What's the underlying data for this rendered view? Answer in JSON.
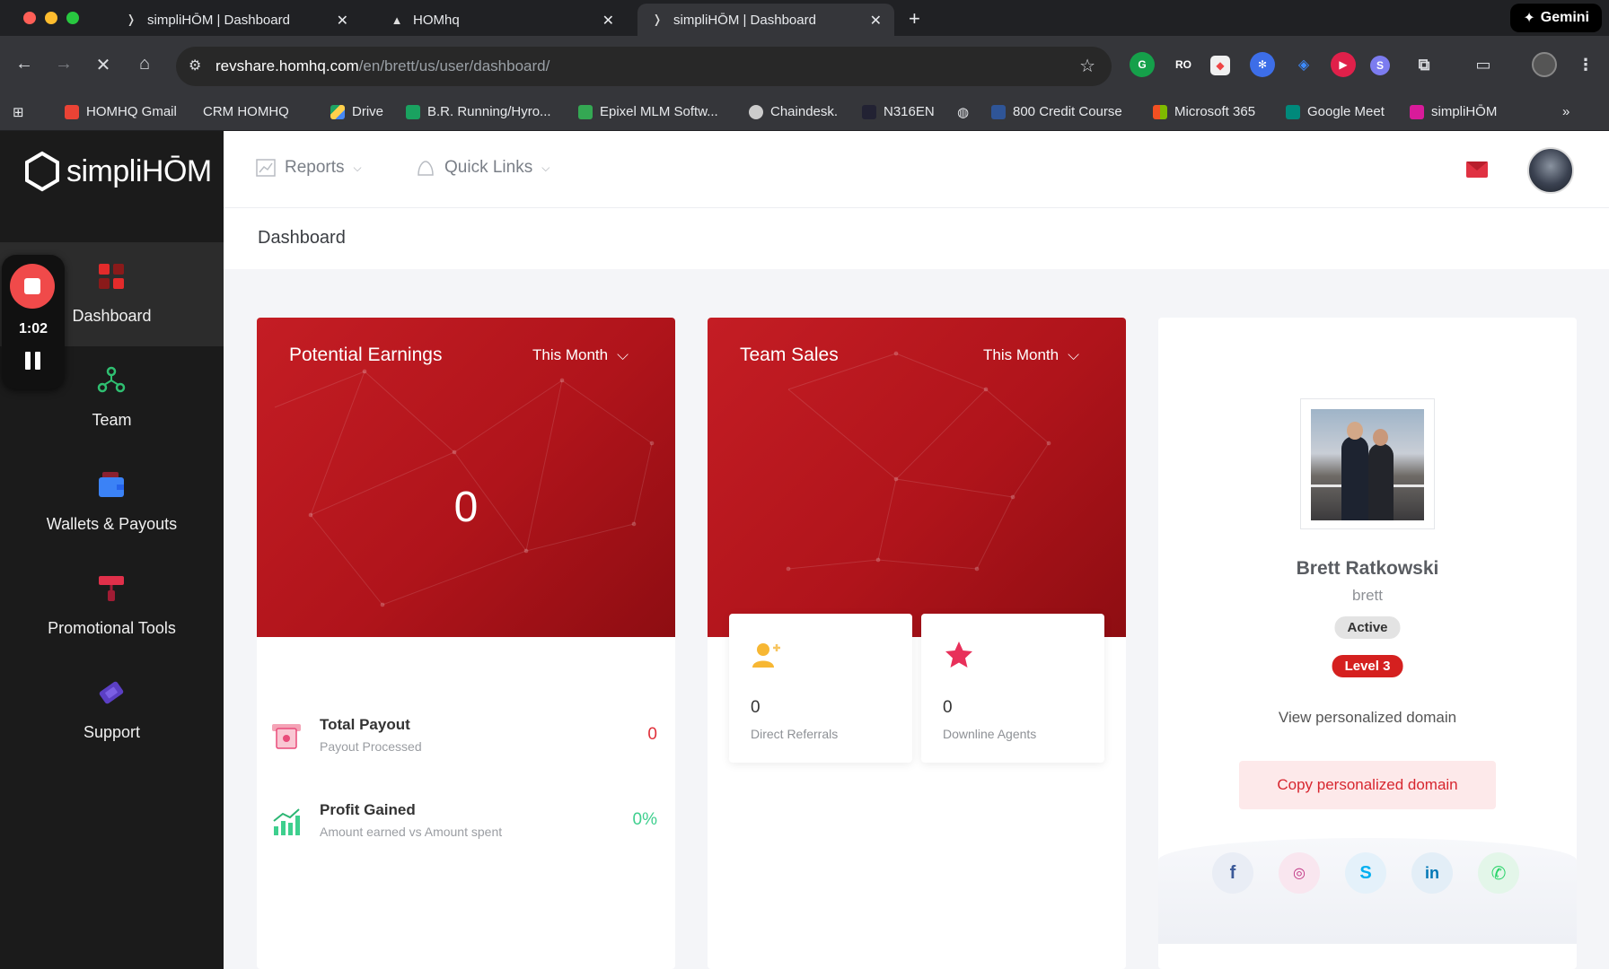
{
  "browser": {
    "tabs": [
      {
        "title": "simpliHŌM | Dashboard"
      },
      {
        "title": "HOMhq"
      },
      {
        "title": "simpliHŌM | Dashboard"
      }
    ],
    "gemini_label": "Gemini",
    "url_host": "revshare.homhq.com",
    "url_path": "/en/brett/us/user/dashboard/",
    "bookmarks": [
      {
        "label": "HOMHQ Gmail"
      },
      {
        "label": "CRM HOMHQ"
      },
      {
        "label": "Drive"
      },
      {
        "label": "B.R. Running/Hyro..."
      },
      {
        "label": "Epixel MLM Softw..."
      },
      {
        "label": "Chaindesk."
      },
      {
        "label": "N316EN"
      },
      {
        "label": "800 Credit Course"
      },
      {
        "label": "Microsoft 365"
      },
      {
        "label": "Google Meet"
      },
      {
        "label": "simpliHŌM"
      }
    ],
    "extensions": [
      "RO"
    ]
  },
  "recorder": {
    "time": "1:02"
  },
  "logo": {
    "text": "simpliHŌM"
  },
  "sidebar": {
    "items": [
      {
        "label": "Dashboard",
        "icon": "dashboard-grid-icon",
        "active": true
      },
      {
        "label": "Team",
        "icon": "team-icon"
      },
      {
        "label": "Wallets & Payouts",
        "icon": "wallet-icon"
      },
      {
        "label": "Promotional Tools",
        "icon": "paint-roller-icon"
      },
      {
        "label": "Support",
        "icon": "ticket-icon"
      }
    ]
  },
  "header": {
    "menus": [
      {
        "label": "Reports",
        "icon": "chart-icon"
      },
      {
        "label": "Quick Links",
        "icon": "link-icon"
      }
    ]
  },
  "breadcrumb": "Dashboard",
  "earnings": {
    "title": "Potential Earnings",
    "period": "This Month",
    "value": "0",
    "stats": [
      {
        "title": "Total Payout",
        "sub": "Payout Processed",
        "value": "0",
        "color": "#e0303a"
      },
      {
        "title": "Profit Gained",
        "sub": "Amount earned vs Amount spent",
        "value": "0%",
        "color": "#3ecf8e"
      }
    ]
  },
  "team_sales": {
    "title": "Team Sales",
    "period": "This Month",
    "cards": [
      {
        "value": "0",
        "label": "Direct Referrals",
        "icon": "add-user-icon"
      },
      {
        "value": "0",
        "label": "Downline Agents",
        "icon": "star-icon"
      }
    ]
  },
  "profile": {
    "name": "Brett Ratkowski",
    "username": "brett",
    "status": "Active",
    "level": "Level 3",
    "view_domain": "View personalized domain",
    "copy_domain": "Copy personalized domain",
    "social": [
      "facebook-icon",
      "instagram-icon",
      "skype-icon",
      "linkedin-icon",
      "whatsapp-icon"
    ]
  },
  "colors": {
    "brand_red": "#c41d24",
    "sidebar_bg": "#1b1b1b"
  }
}
